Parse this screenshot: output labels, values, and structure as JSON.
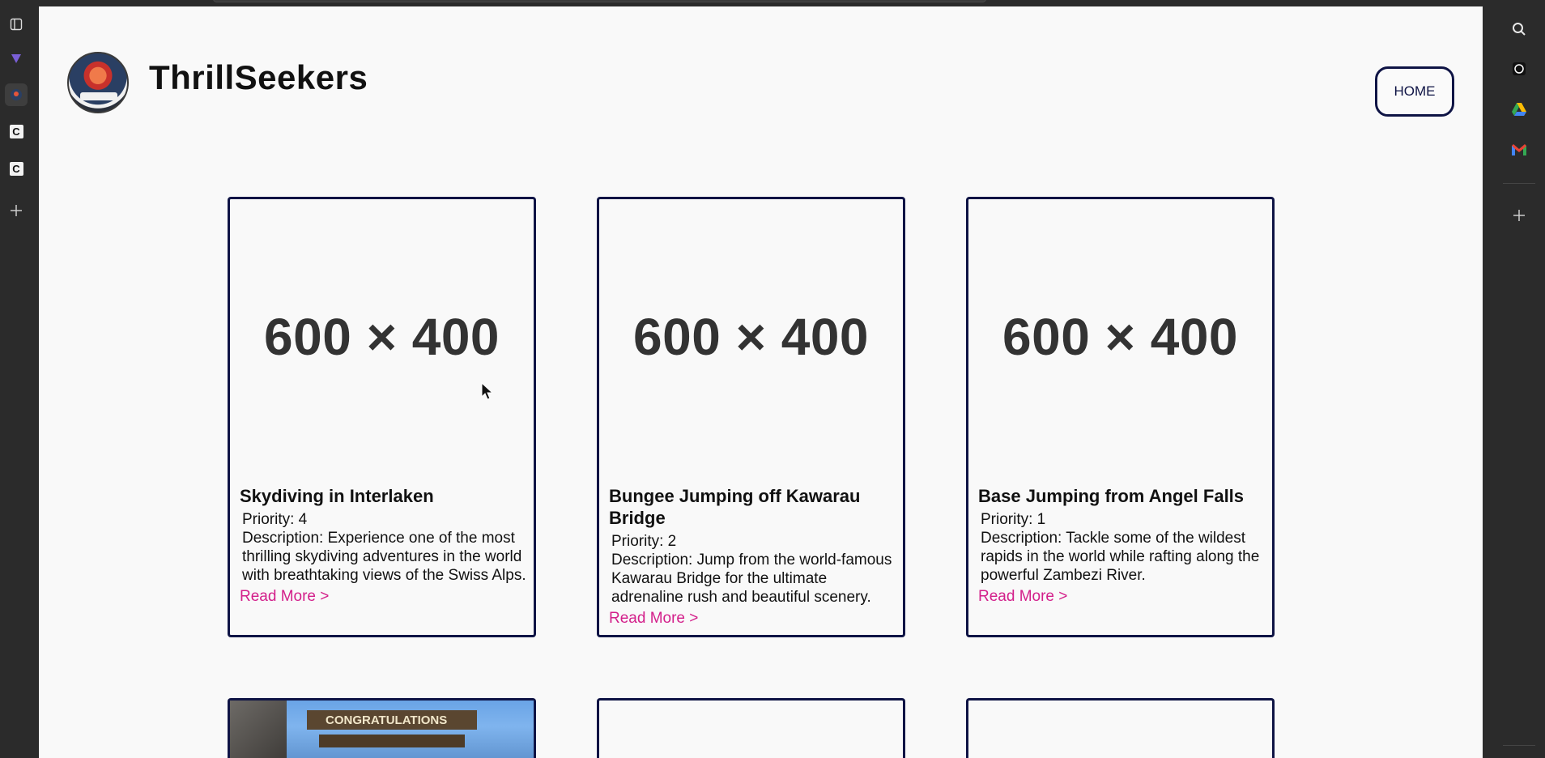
{
  "site": {
    "title": "ThrillSeekers",
    "logo_text": "THRILLSEEKERS",
    "nav": {
      "home_label": "HOME"
    }
  },
  "cards": [
    {
      "image_placeholder": "600 × 400",
      "title": "Skydiving in Interlaken",
      "priority": "Priority: 4",
      "description": "Description: Experience one of the most thrilling skydiving adventures in the world with breathtaking views of the Swiss Alps.",
      "link": "Read More >"
    },
    {
      "image_placeholder": "600 × 400",
      "title": "Bungee Jumping off Kawarau Bridge",
      "priority": "Priority: 2",
      "description": "Description: Jump from the world-famous Kawarau Bridge for the ultimate adrenaline rush and beautiful scenery.",
      "link": "Read More >"
    },
    {
      "image_placeholder": "600 × 400",
      "title": "Base Jumping from Angel Falls",
      "priority": "Priority: 1",
      "description": "Description: Tackle some of the wildest rapids in the world while rafting along the powerful Zambezi River.",
      "link": "Read More >"
    }
  ],
  "next_row": {
    "photo_sign_text": "CONGRATULATIONS"
  },
  "browser": {
    "left_rail_icons": [
      "sidebar-toggle-icon",
      "vivaldi-icon",
      "thrillseekers-tab-icon",
      "c-tab-icon",
      "c-tab-icon",
      "add-tab-icon"
    ],
    "right_rail_icons": [
      "search-icon",
      "chatgpt-icon",
      "google-drive-icon",
      "gmail-icon",
      "add-panel-icon"
    ]
  },
  "colors": {
    "accent_navy": "#0f1445",
    "link_pink": "#d31f8a",
    "page_bg": "#f9f9f9",
    "chrome_bg": "#2b2b2b"
  }
}
